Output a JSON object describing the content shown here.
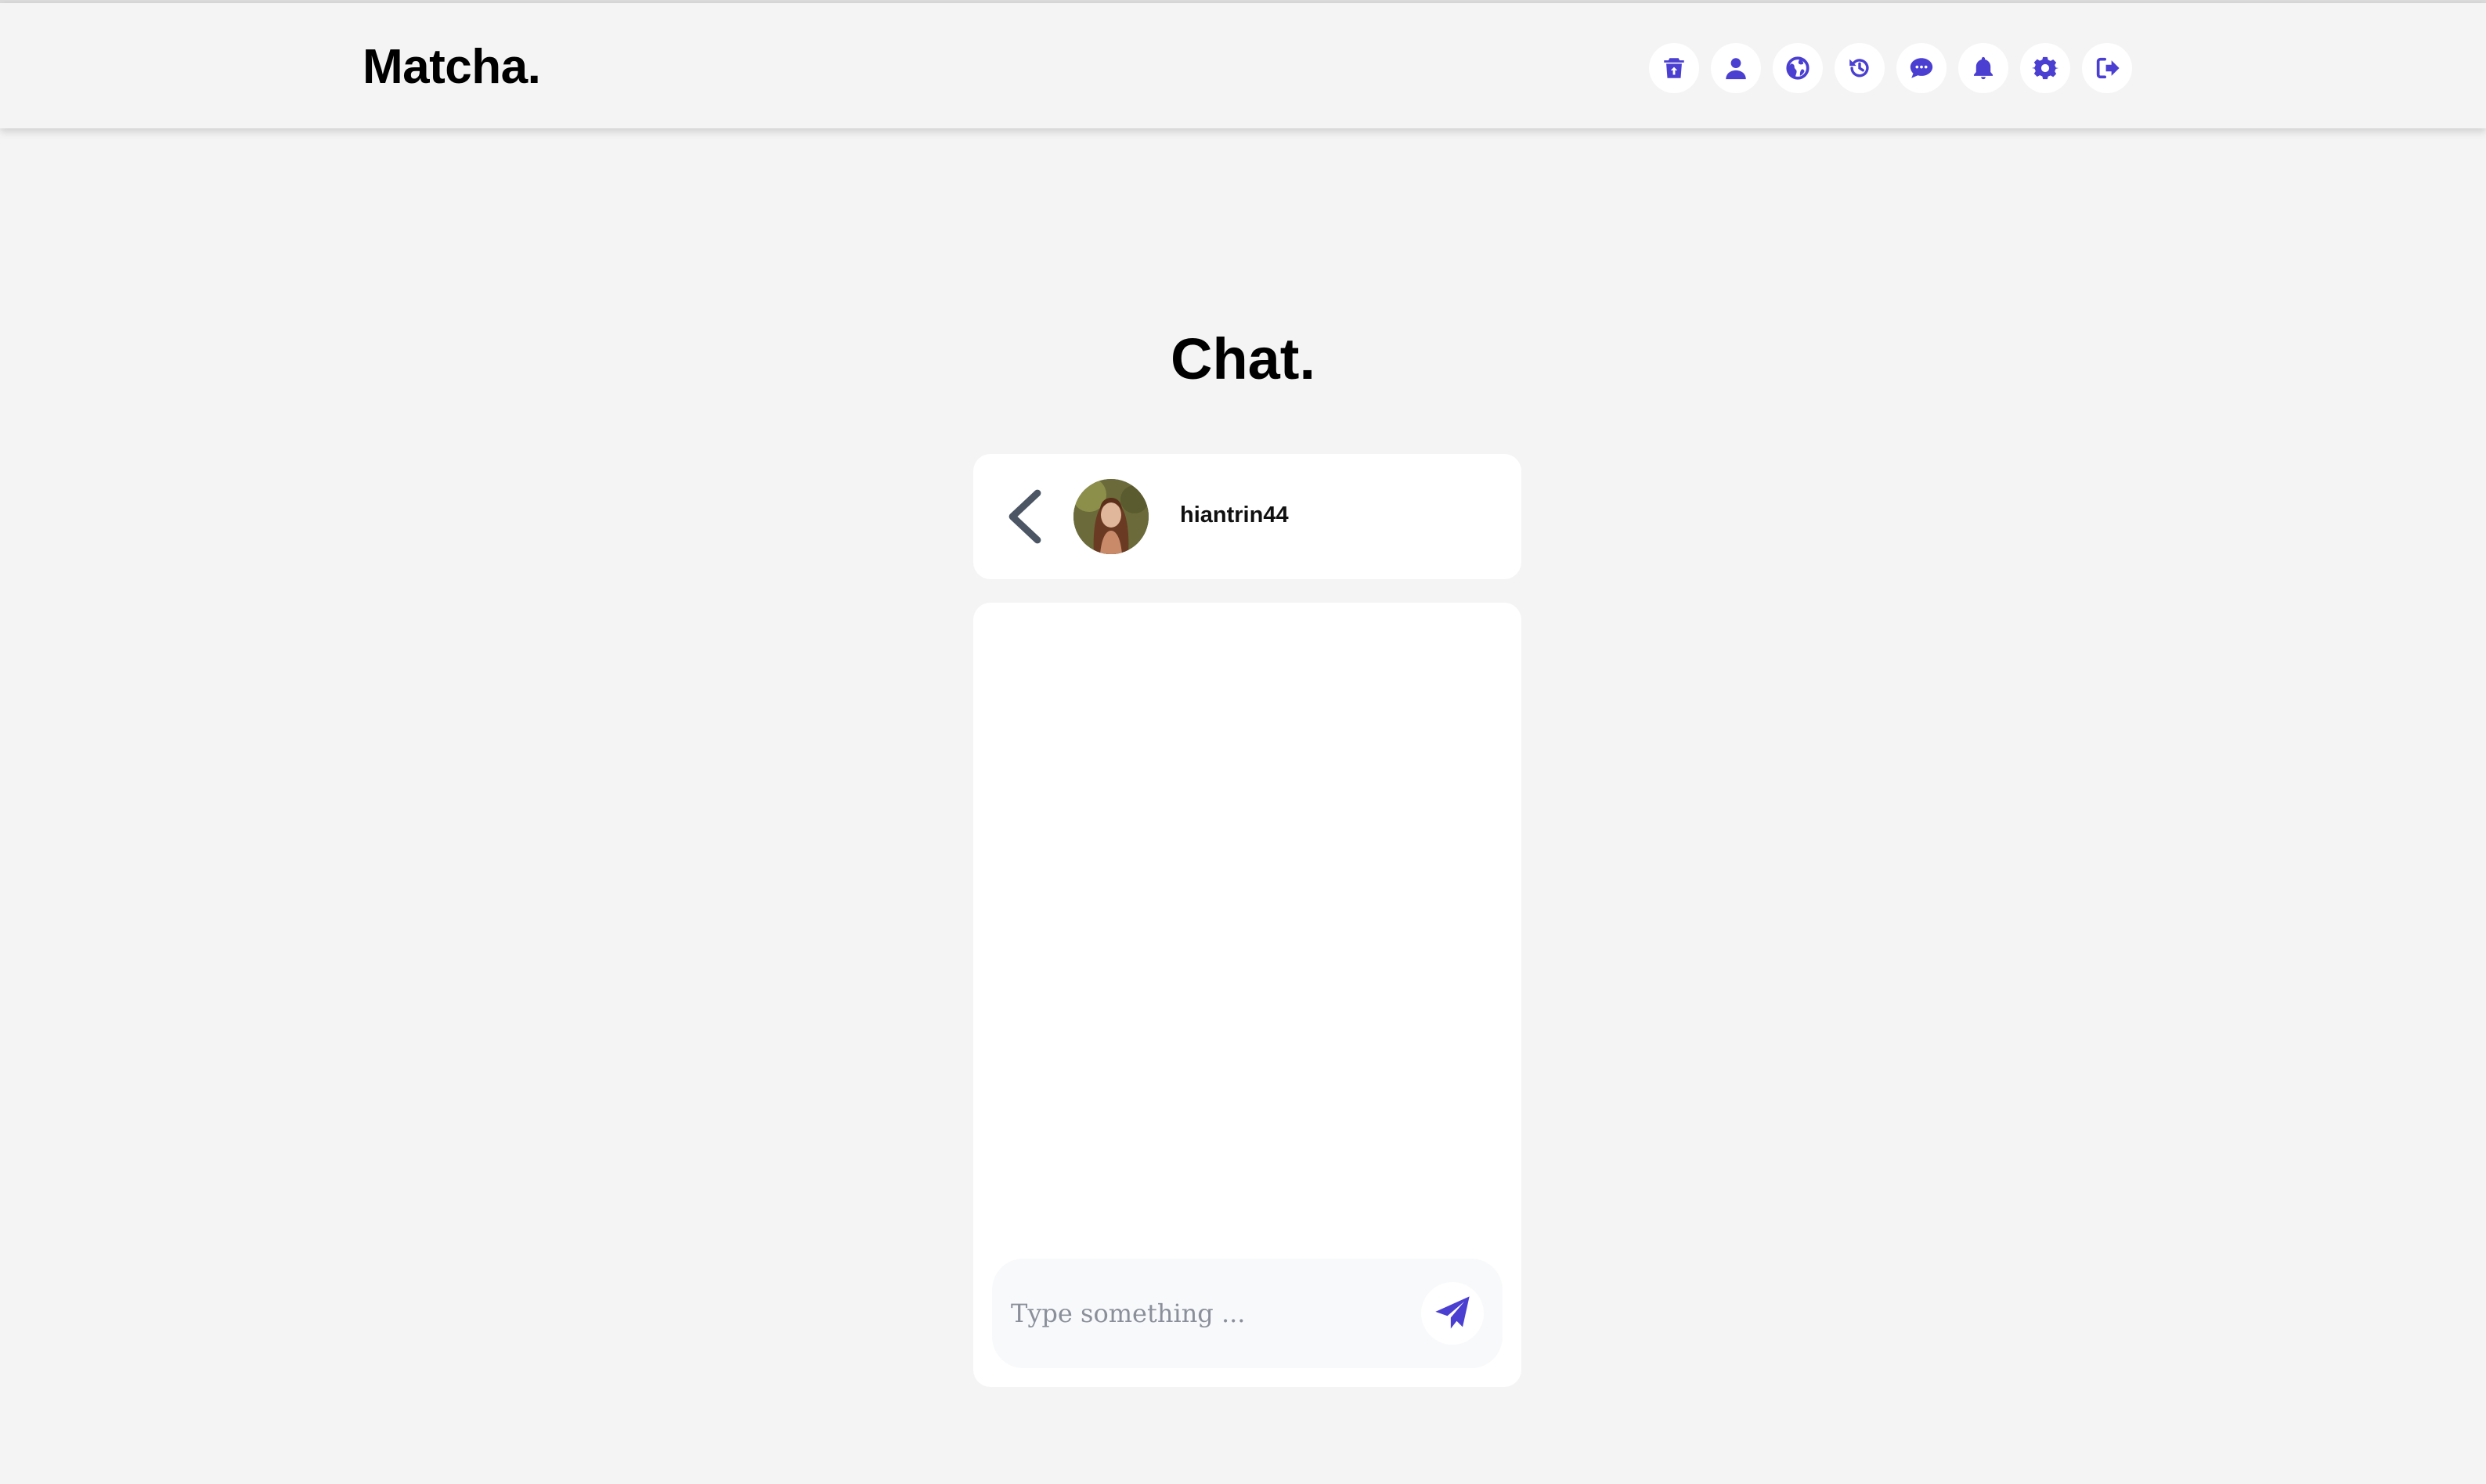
{
  "app": {
    "logo": "Matcha."
  },
  "colors": {
    "accent": "#4a3fd1",
    "background": "#f4f4f4",
    "card": "#ffffff"
  },
  "nav": {
    "icons": [
      "trash-icon",
      "user-icon",
      "globe-icon",
      "history-icon",
      "chat-icon",
      "bell-icon",
      "gear-icon",
      "logout-icon"
    ]
  },
  "page": {
    "title": "Chat."
  },
  "conversation": {
    "username": "hiantrin44",
    "avatar": "avatar-photo",
    "messages": []
  },
  "composer": {
    "placeholder": "Type something ...",
    "value": "",
    "send_icon": "paper-plane-icon"
  }
}
